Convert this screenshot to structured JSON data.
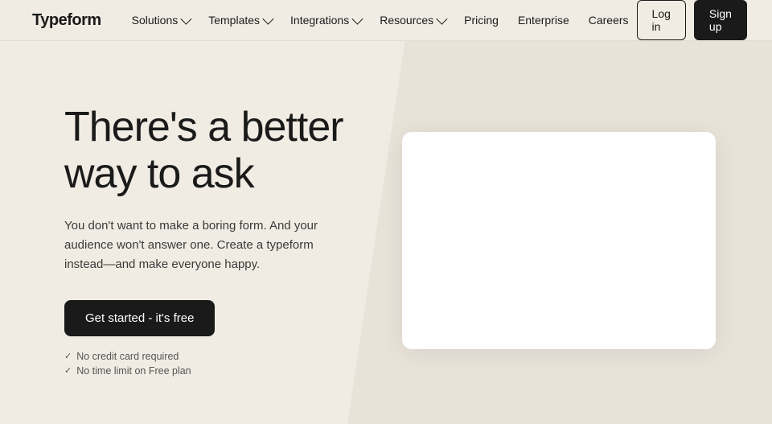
{
  "brand": {
    "logo": "Typeform"
  },
  "nav": {
    "links": [
      {
        "label": "Solutions",
        "has_dropdown": true
      },
      {
        "label": "Templates",
        "has_dropdown": true
      },
      {
        "label": "Integrations",
        "has_dropdown": true
      },
      {
        "label": "Resources",
        "has_dropdown": true
      },
      {
        "label": "Pricing",
        "has_dropdown": false
      },
      {
        "label": "Enterprise",
        "has_dropdown": false
      },
      {
        "label": "Careers",
        "has_dropdown": false
      }
    ],
    "login_label": "Log in",
    "signup_label": "Sign up"
  },
  "hero": {
    "title": "There's a better way to ask",
    "description": "You don't want to make a boring form. And your audience won't answer one. Create a typeform instead—and make everyone happy.",
    "cta_label": "Get started - it's free",
    "checks": [
      "No credit card required",
      "No time limit on Free plan"
    ]
  }
}
